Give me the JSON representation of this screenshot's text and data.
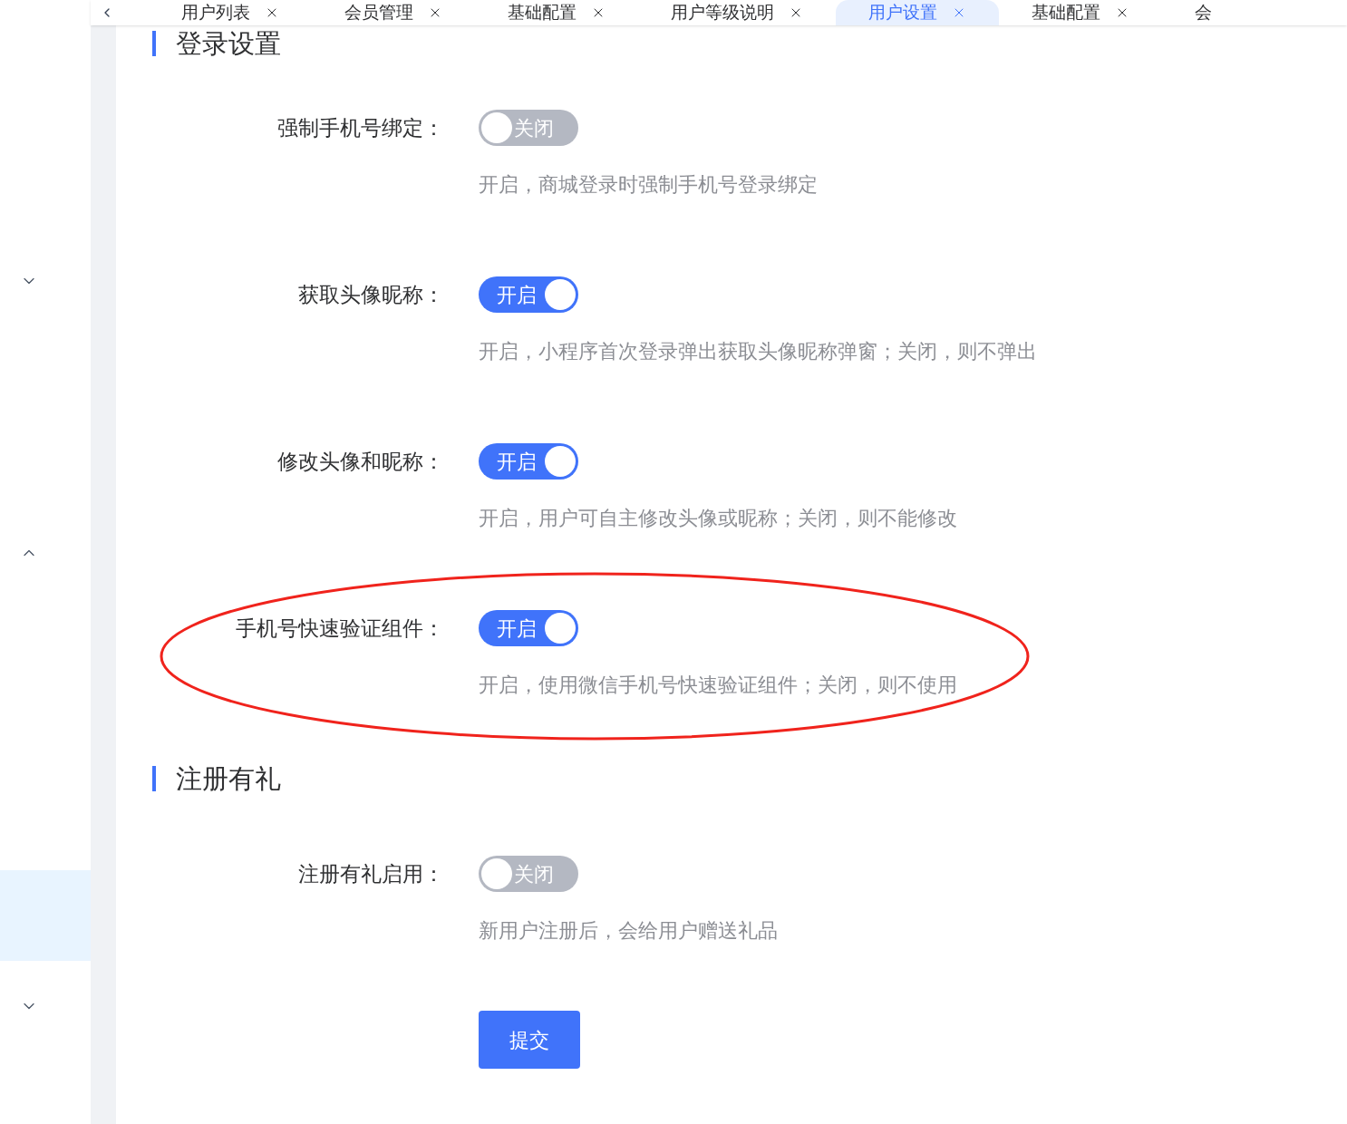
{
  "tabs": [
    {
      "label": "用户列表",
      "selected": false,
      "closable": true
    },
    {
      "label": "会员管理",
      "selected": false,
      "closable": true
    },
    {
      "label": "基础配置",
      "selected": false,
      "closable": true
    },
    {
      "label": "用户等级说明",
      "selected": false,
      "closable": true
    },
    {
      "label": "用户设置",
      "selected": true,
      "closable": true
    },
    {
      "label": "基础配置",
      "selected": false,
      "closable": true
    },
    {
      "label": "会",
      "selected": false,
      "closable": false
    }
  ],
  "sidebar": {
    "rows": [
      {
        "kind": "group",
        "expanded": false
      },
      {
        "kind": "group",
        "expanded": true
      },
      {
        "kind": "item",
        "selected": true
      },
      {
        "kind": "group",
        "expanded": false
      }
    ]
  },
  "sections": [
    {
      "title": "登录设置",
      "fields": [
        {
          "label": "强制手机号绑定：",
          "on": false,
          "switch_text": "关闭",
          "description": "开启，商城登录时强制手机号登录绑定",
          "highlighted": false
        },
        {
          "label": "获取头像昵称：",
          "on": true,
          "switch_text": "开启",
          "description": "开启，小程序首次登录弹出获取头像昵称弹窗；关闭，则不弹出",
          "highlighted": false
        },
        {
          "label": "修改头像和昵称：",
          "on": true,
          "switch_text": "开启",
          "description": "开启，用户可自主修改头像或昵称；关闭，则不能修改",
          "highlighted": false
        },
        {
          "label": "手机号快速验证组件：",
          "on": true,
          "switch_text": "开启",
          "description": "开启，使用微信手机号快速验证组件；关闭，则不使用",
          "highlighted": true
        }
      ]
    },
    {
      "title": "注册有礼",
      "fields": [
        {
          "label": "注册有礼启用：",
          "on": false,
          "switch_text": "关闭",
          "description": "新用户注册后，会给用户赠送礼品",
          "highlighted": false
        }
      ]
    }
  ],
  "submit": {
    "label": "提交"
  }
}
